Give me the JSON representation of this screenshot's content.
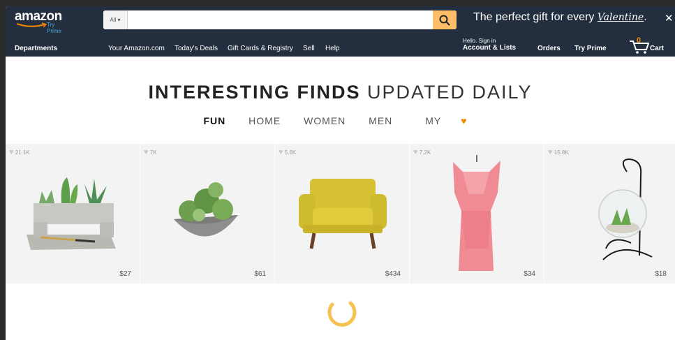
{
  "header": {
    "logo": {
      "text": "amazon",
      "sub": "Try Prime"
    },
    "search": {
      "category": "All",
      "value": ""
    },
    "promo": {
      "text": "The perfect gift for every",
      "script": "Valentine",
      "suffix": "."
    },
    "nav": {
      "departments": "Departments",
      "links": [
        "Your Amazon.com",
        "Today's Deals",
        "Gift Cards & Registry",
        "Sell",
        "Help"
      ],
      "account_small": "Hello. Sign in",
      "account_big": "Account & Lists",
      "orders": "Orders",
      "try_prime": "Try Prime",
      "cart_count": "0",
      "cart_label": "Cart"
    }
  },
  "main": {
    "title_bold": "INTERESTING FINDS",
    "title_light": "UPDATED DAILY",
    "tabs": [
      "FUN",
      "HOME",
      "WOMEN",
      "MEN",
      "MY"
    ],
    "products": [
      {
        "likes": "21.1K",
        "price": "$27"
      },
      {
        "likes": "7K",
        "price": "$61"
      },
      {
        "likes": "5.6K",
        "price": "$434"
      },
      {
        "likes": "7.2K",
        "price": "$34"
      },
      {
        "likes": "15.8K",
        "price": "$18"
      }
    ]
  },
  "colors": {
    "nav_bg": "#232f3e",
    "search_button": "#febd69",
    "accent": "#f08804",
    "card_bg": "#f3f3f3"
  }
}
